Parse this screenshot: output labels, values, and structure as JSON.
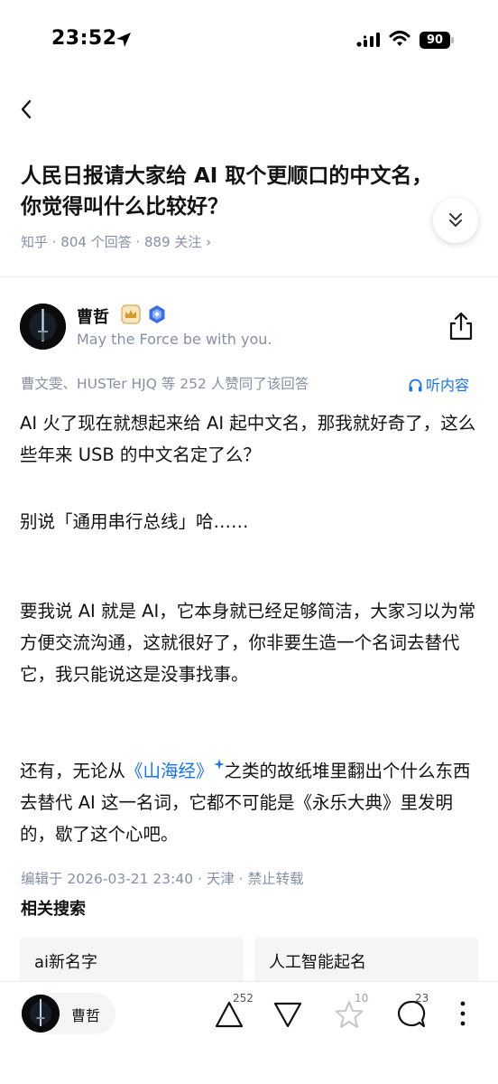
{
  "status_bar": {
    "time": "23:52",
    "battery": "90"
  },
  "question": {
    "title": "人民日报请大家给 AI 取个更顺口的中文名，你觉得叫什么比较好？",
    "meta": "知乎 · 804 个回答 · 889 关注 ›"
  },
  "author": {
    "name": "曹哲",
    "bio": "May the Force be with you."
  },
  "answer": {
    "vote_summary": "曹文雯、HUSTer HJQ 等 252 人赞同了该回答",
    "listen_label": "听内容",
    "para1": "AI 火了现在就想起来给 AI 起中文名，那我就好奇了，这么些年来 USB 的中文名定了么？",
    "para2": "别说「通用串行总线」哈……",
    "para3": "要我说 AI 就是 AI，它本身就已经足够简洁，大家习以为常方便交流沟通，这就很好了，你非要生造一个名词去替代它，我只能说这是没事找事。",
    "para4_before": "还有，无论从",
    "para4_link": "《山海经》",
    "para4_after": "之类的故纸堆里翻出个什么东西去替代 AI 这一名词，它都不可能是《永乐大典》里发明的，歇了这个心吧。",
    "edit_meta": "编辑于 2026-03-21 23:40 · 天津 · 禁止转载"
  },
  "related": {
    "title": "相关搜索",
    "items": [
      "ai新名字",
      "人工智能起名"
    ]
  },
  "bottom_bar": {
    "author_name": "曹哲",
    "upvotes": "252",
    "favorites": "10",
    "comments": "23"
  },
  "colors": {
    "accent": "#1772f6",
    "meta_gray": "#8590a6"
  }
}
